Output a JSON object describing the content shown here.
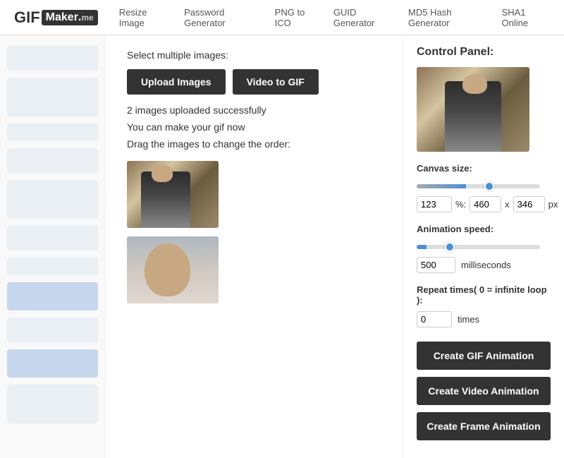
{
  "header": {
    "logo_gif": "GIF",
    "logo_maker": "Maker",
    "logo_dot": ".",
    "logo_me": "me",
    "nav": [
      {
        "label": "Resize Image",
        "id": "resize-image"
      },
      {
        "label": "Password Generator",
        "id": "password-generator"
      },
      {
        "label": "PNG to ICO",
        "id": "png-to-ico"
      },
      {
        "label": "GUID Generator",
        "id": "guid-generator"
      },
      {
        "label": "MD5 Hash Generator",
        "id": "md5-hash-generator"
      },
      {
        "label": "SHA1 Online",
        "id": "sha1-online"
      }
    ]
  },
  "content": {
    "select_label": "Select multiple images:",
    "upload_button": "Upload Images",
    "video_button": "Video to GIF",
    "upload_status": "2 images uploaded successfully",
    "make_gif_text": "You can make your gif now",
    "drag_text": "Drag the images to change the order:"
  },
  "control_panel": {
    "title": "Control Panel:",
    "canvas_size_label": "Canvas size:",
    "canvas_pct": "123",
    "canvas_pct_symbol": "%:",
    "canvas_width": "460",
    "canvas_x": "x",
    "canvas_height": "346",
    "canvas_px": "px",
    "anim_speed_label": "Animation speed:",
    "anim_speed_value": "500",
    "anim_speed_unit": "milliseconds",
    "repeat_label": "Repeat times( 0 = infinite loop ):",
    "repeat_value": "0",
    "repeat_unit": "times",
    "btn_gif": "Create GIF Animation",
    "btn_video": "Create Video Animation",
    "btn_frame": "Create Frame Animation"
  }
}
